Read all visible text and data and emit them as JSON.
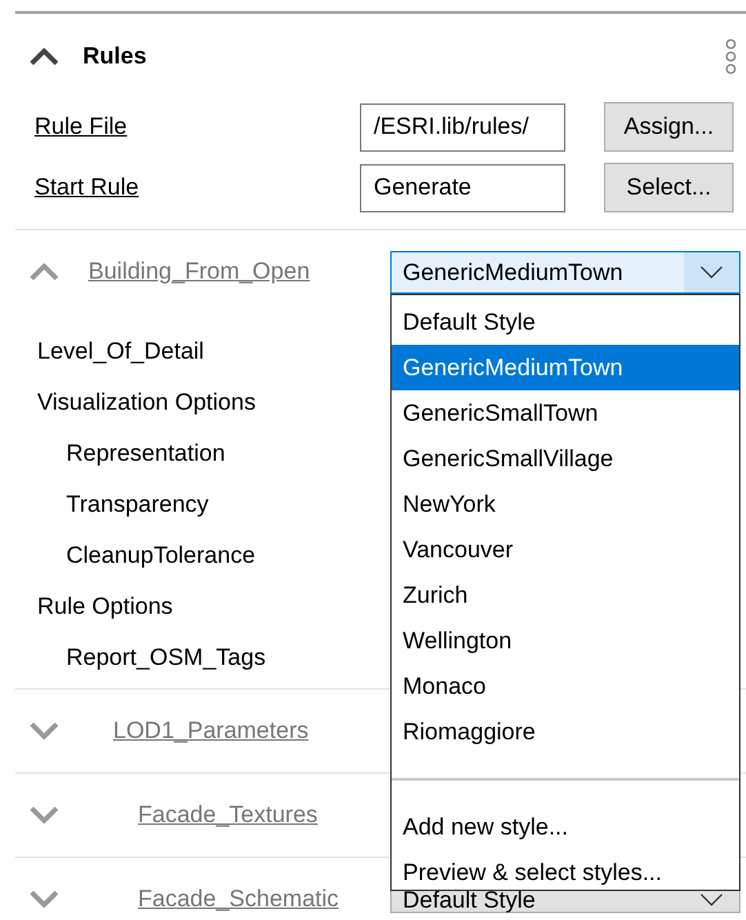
{
  "rules": {
    "title": "Rules",
    "expanded": true,
    "fields": [
      {
        "label": "Rule File",
        "value": "/ESRI.lib/rules/",
        "button": "Assign..."
      },
      {
        "label": "Start Rule",
        "value": "Generate",
        "button": "Select..."
      }
    ]
  },
  "sections": [
    {
      "title": "Building_From_Open",
      "expanded": true,
      "style": "GenericMediumTown",
      "attributes": [
        {
          "label": "Level_Of_Detail"
        },
        {
          "label": "Visualization Options",
          "children": [
            {
              "label": "Representation"
            },
            {
              "label": "Transparency"
            },
            {
              "label": "CleanupTolerance"
            }
          ]
        },
        {
          "label": "Rule Options",
          "children": [
            {
              "label": "Report_OSM_Tags"
            }
          ]
        }
      ]
    },
    {
      "title": "LOD1_Parameters",
      "expanded": false
    },
    {
      "title": "Facade_Textures",
      "expanded": false
    },
    {
      "title": "Facade_Schematic",
      "expanded": false,
      "style": "Default Style"
    }
  ],
  "style_dropdown": {
    "open": true,
    "options": [
      {
        "label": "Default Style",
        "selected": false
      },
      {
        "label": "GenericMediumTown",
        "selected": true
      },
      {
        "label": "GenericSmallTown",
        "selected": false
      },
      {
        "label": "GenericSmallVillage",
        "selected": false
      },
      {
        "label": "NewYork",
        "selected": false
      },
      {
        "label": "Vancouver",
        "selected": false
      },
      {
        "label": "Zurich",
        "selected": false
      },
      {
        "label": "Wellington",
        "selected": false
      },
      {
        "label": "Monaco",
        "selected": false
      },
      {
        "label": "Riomaggiore",
        "selected": false
      }
    ],
    "actions": [
      "Add new style...",
      "Preview & select styles..."
    ]
  }
}
